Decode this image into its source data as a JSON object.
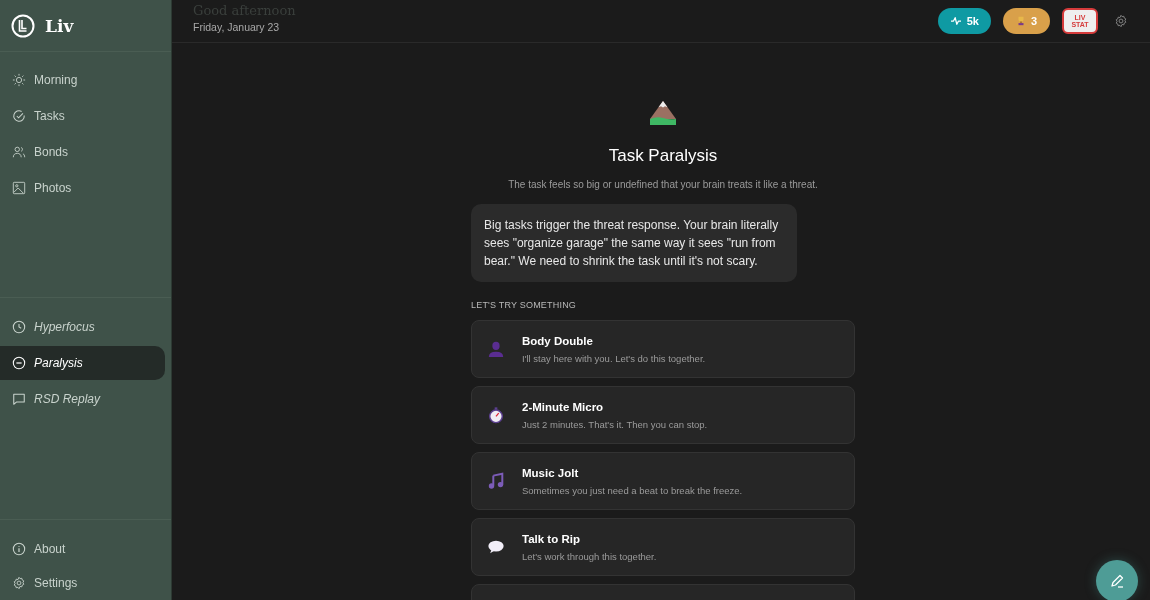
{
  "brand": {
    "name": "Liv"
  },
  "nav": [
    {
      "label": "Morning",
      "kind": "sun",
      "selected": false
    },
    {
      "label": "Tasks",
      "kind": "check",
      "selected": false
    },
    {
      "label": "Bonds",
      "kind": "people",
      "selected": false
    },
    {
      "label": "Photos",
      "kind": "image",
      "selected": false
    }
  ],
  "tools": [
    {
      "label": "Hyperfocus",
      "kind": "clock",
      "selected": false
    },
    {
      "label": "Paralysis",
      "kind": "minus",
      "selected": true
    },
    {
      "label": "RSD Replay",
      "kind": "chat",
      "selected": false
    }
  ],
  "footer": [
    {
      "label": "About",
      "kind": "info"
    },
    {
      "label": "Settings",
      "kind": "gear"
    }
  ],
  "header": {
    "greeting": "Good afternoon",
    "date": "Friday, January 23",
    "badges": [
      {
        "kind": "pulse",
        "label": "5k"
      },
      {
        "kind": "trophy",
        "label": "3"
      }
    ],
    "stat_button": {
      "line1": "LIV",
      "line2": "STAT"
    }
  },
  "hero": {
    "title": "Task Paralysis",
    "subtitle": "The task feels so big or undefined that your brain treats it like a threat."
  },
  "message": "Big tasks trigger the threat response. Your brain literally sees \"organize garage\" the same way it sees \"run from bear.\" We need to shrink the task until it's not scary.",
  "section_label": "LET'S TRY SOMETHING",
  "options": [
    {
      "kind": "person",
      "title": "Body Double",
      "description": "I'll stay here with you. Let's do this together."
    },
    {
      "kind": "stopwatch",
      "title": "2-Minute Micro",
      "description": "Just 2 minutes. That's it. Then you can stop."
    },
    {
      "kind": "music",
      "title": "Music Jolt",
      "description": "Sometimes you just need a beat to break the freeze."
    },
    {
      "kind": "speech",
      "title": "Talk to Rip",
      "description": "Let's work through this together."
    }
  ]
}
